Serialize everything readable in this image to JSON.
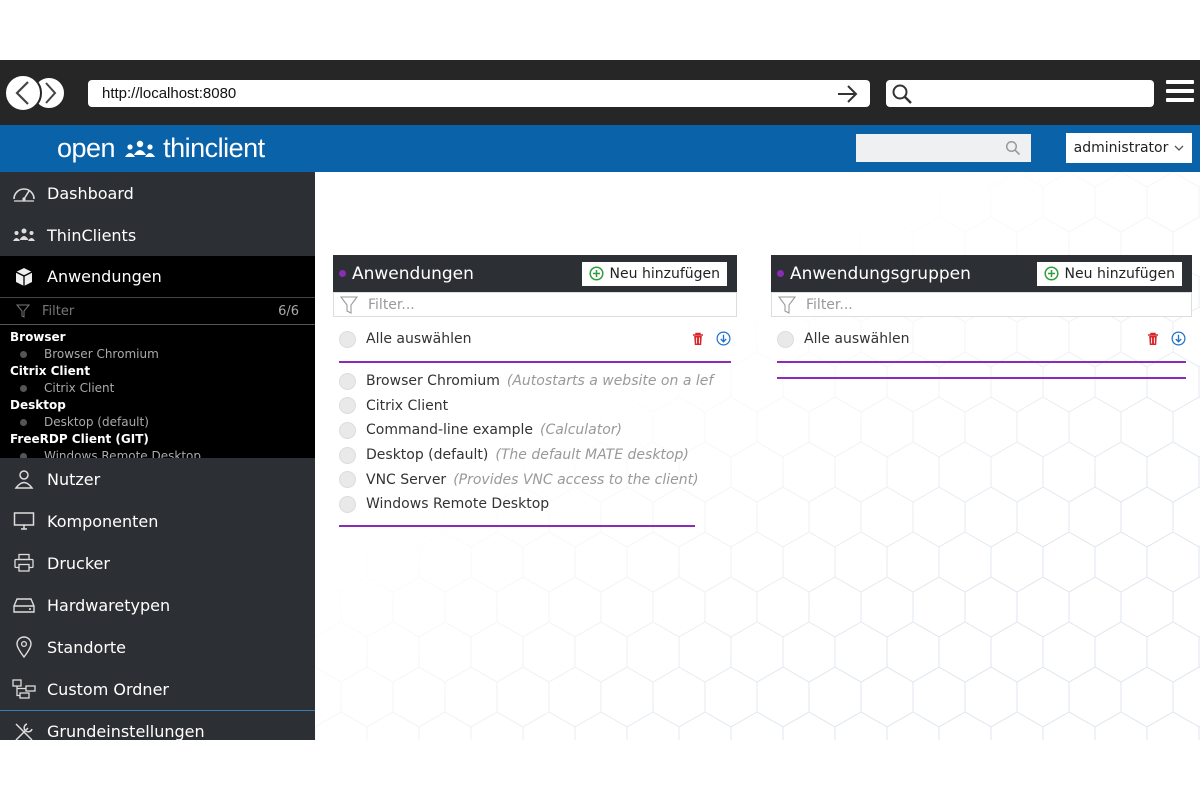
{
  "browser": {
    "url": "http://localhost:8080"
  },
  "header": {
    "logo_left": "open",
    "logo_right": "thinclient",
    "user": "administrator"
  },
  "sidebar": {
    "items_top": [
      {
        "label": "Dashboard",
        "icon": "dashboard-icon"
      },
      {
        "label": "ThinClients",
        "icon": "thinclients-icon"
      },
      {
        "label": "Anwendungen",
        "icon": "cube-icon"
      }
    ],
    "filter": {
      "placeholder": "Filter",
      "count": "6/6"
    },
    "groups": [
      {
        "title": "Browser",
        "items": [
          "Browser Chromium"
        ]
      },
      {
        "title": "Citrix Client",
        "items": [
          "Citrix Client"
        ]
      },
      {
        "title": "Desktop",
        "items": [
          "Desktop (default)"
        ]
      },
      {
        "title": "FreeRDP Client (GIT)",
        "items": [
          "Windows Remote Desktop"
        ]
      }
    ],
    "items_bottom": [
      {
        "label": "Nutzer",
        "icon": "user-icon"
      },
      {
        "label": "Komponenten",
        "icon": "monitor-icon"
      },
      {
        "label": "Drucker",
        "icon": "printer-icon"
      },
      {
        "label": "Hardwaretypen",
        "icon": "hardware-icon"
      },
      {
        "label": "Standorte",
        "icon": "location-pin-icon"
      },
      {
        "label": "Custom Ordner",
        "icon": "folder-tree-icon"
      }
    ],
    "settings_label": "Grundeinstellungen"
  },
  "applications_panel": {
    "title": "Anwendungen",
    "add_label": "Neu hinzufügen",
    "filter_placeholder": "Filter...",
    "select_all": "Alle auswählen",
    "rows": [
      {
        "name": "Browser Chromium",
        "desc": "(Autostarts a website on a lef"
      },
      {
        "name": "Citrix Client",
        "desc": ""
      },
      {
        "name": "Command-line example",
        "desc": "(Calculator)"
      },
      {
        "name": "Desktop (default)",
        "desc": "(The default MATE desktop)"
      },
      {
        "name": "VNC Server",
        "desc": "(Provides VNC access to the client)"
      },
      {
        "name": "Windows Remote Desktop",
        "desc": ""
      }
    ]
  },
  "groups_panel": {
    "title": "Anwendungsgruppen",
    "add_label": "Neu hinzufügen",
    "filter_placeholder": "Filter...",
    "select_all": "Alle auswählen"
  },
  "colors": {
    "header_blue": "#0a63a8",
    "sidebar_dark": "#2c2f33",
    "accent_purple": "#8c2bb5",
    "add_green": "#2e9e3e",
    "delete_red": "#d9262b",
    "download_blue": "#1c6fd1"
  }
}
